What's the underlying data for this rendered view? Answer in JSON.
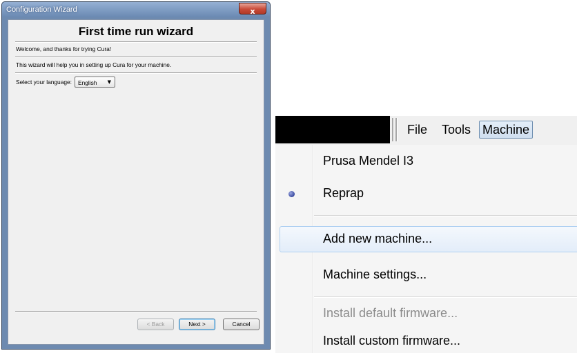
{
  "wizard": {
    "window_title": "Configuration Wizard",
    "close_glyph": "x",
    "heading": "First time run wizard",
    "welcome_text": "Welcome, and thanks for trying Cura!",
    "help_text": "This wizard will help you in setting up Cura for your machine.",
    "language_label": "Select your language:",
    "language_value": "English",
    "back_label": "< Back",
    "next_label": "Next >",
    "cancel_label": "Cancel"
  },
  "menubar": {
    "items": [
      "File",
      "Tools",
      "Machine"
    ],
    "active": "Machine"
  },
  "machine_menu": {
    "items": [
      {
        "label": "Prusa Mendel I3",
        "checked": false,
        "enabled": true
      },
      {
        "label": "Reprap",
        "checked": true,
        "enabled": true
      },
      {
        "label": "Add new machine...",
        "highlighted": true,
        "enabled": true
      },
      {
        "label": "Machine settings...",
        "enabled": true
      },
      {
        "label": "Install default firmware...",
        "enabled": false
      },
      {
        "label": "Install custom firmware...",
        "enabled": true
      }
    ]
  },
  "colors": {
    "titlebar": "#6a89b2",
    "close_button": "#c84a38",
    "menu_highlight": "#aecff2",
    "radio_dot": "#3a4aa0"
  }
}
